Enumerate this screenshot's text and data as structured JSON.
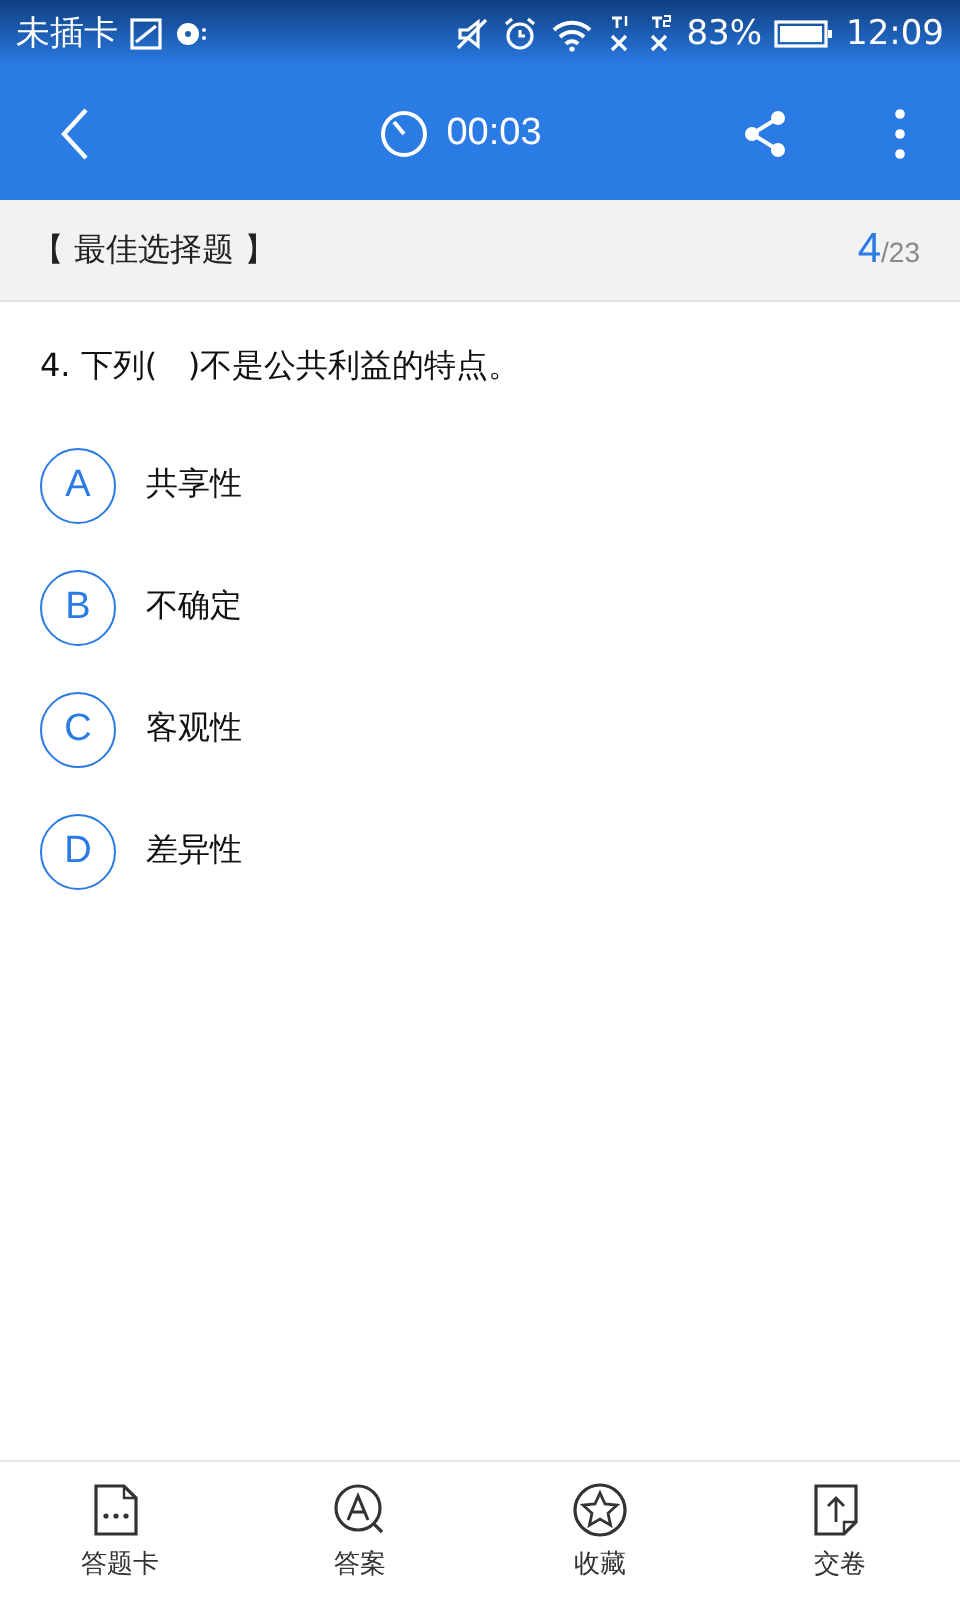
{
  "status_bar": {
    "carrier": "未插卡",
    "battery_percent": "83%",
    "time": "12:09"
  },
  "header": {
    "timer": "00:03"
  },
  "section": {
    "title": "【 最佳选择题 】",
    "current": "4",
    "total": "/23"
  },
  "question": {
    "text": "4. 下列(   )不是公共利益的特点。",
    "options": [
      {
        "letter": "A",
        "text": "共享性"
      },
      {
        "letter": "B",
        "text": "不确定"
      },
      {
        "letter": "C",
        "text": "客观性"
      },
      {
        "letter": "D",
        "text": "差异性"
      }
    ]
  },
  "bottom_bar": [
    {
      "label": "答题卡"
    },
    {
      "label": "答案"
    },
    {
      "label": "收藏"
    },
    {
      "label": "交卷"
    }
  ]
}
